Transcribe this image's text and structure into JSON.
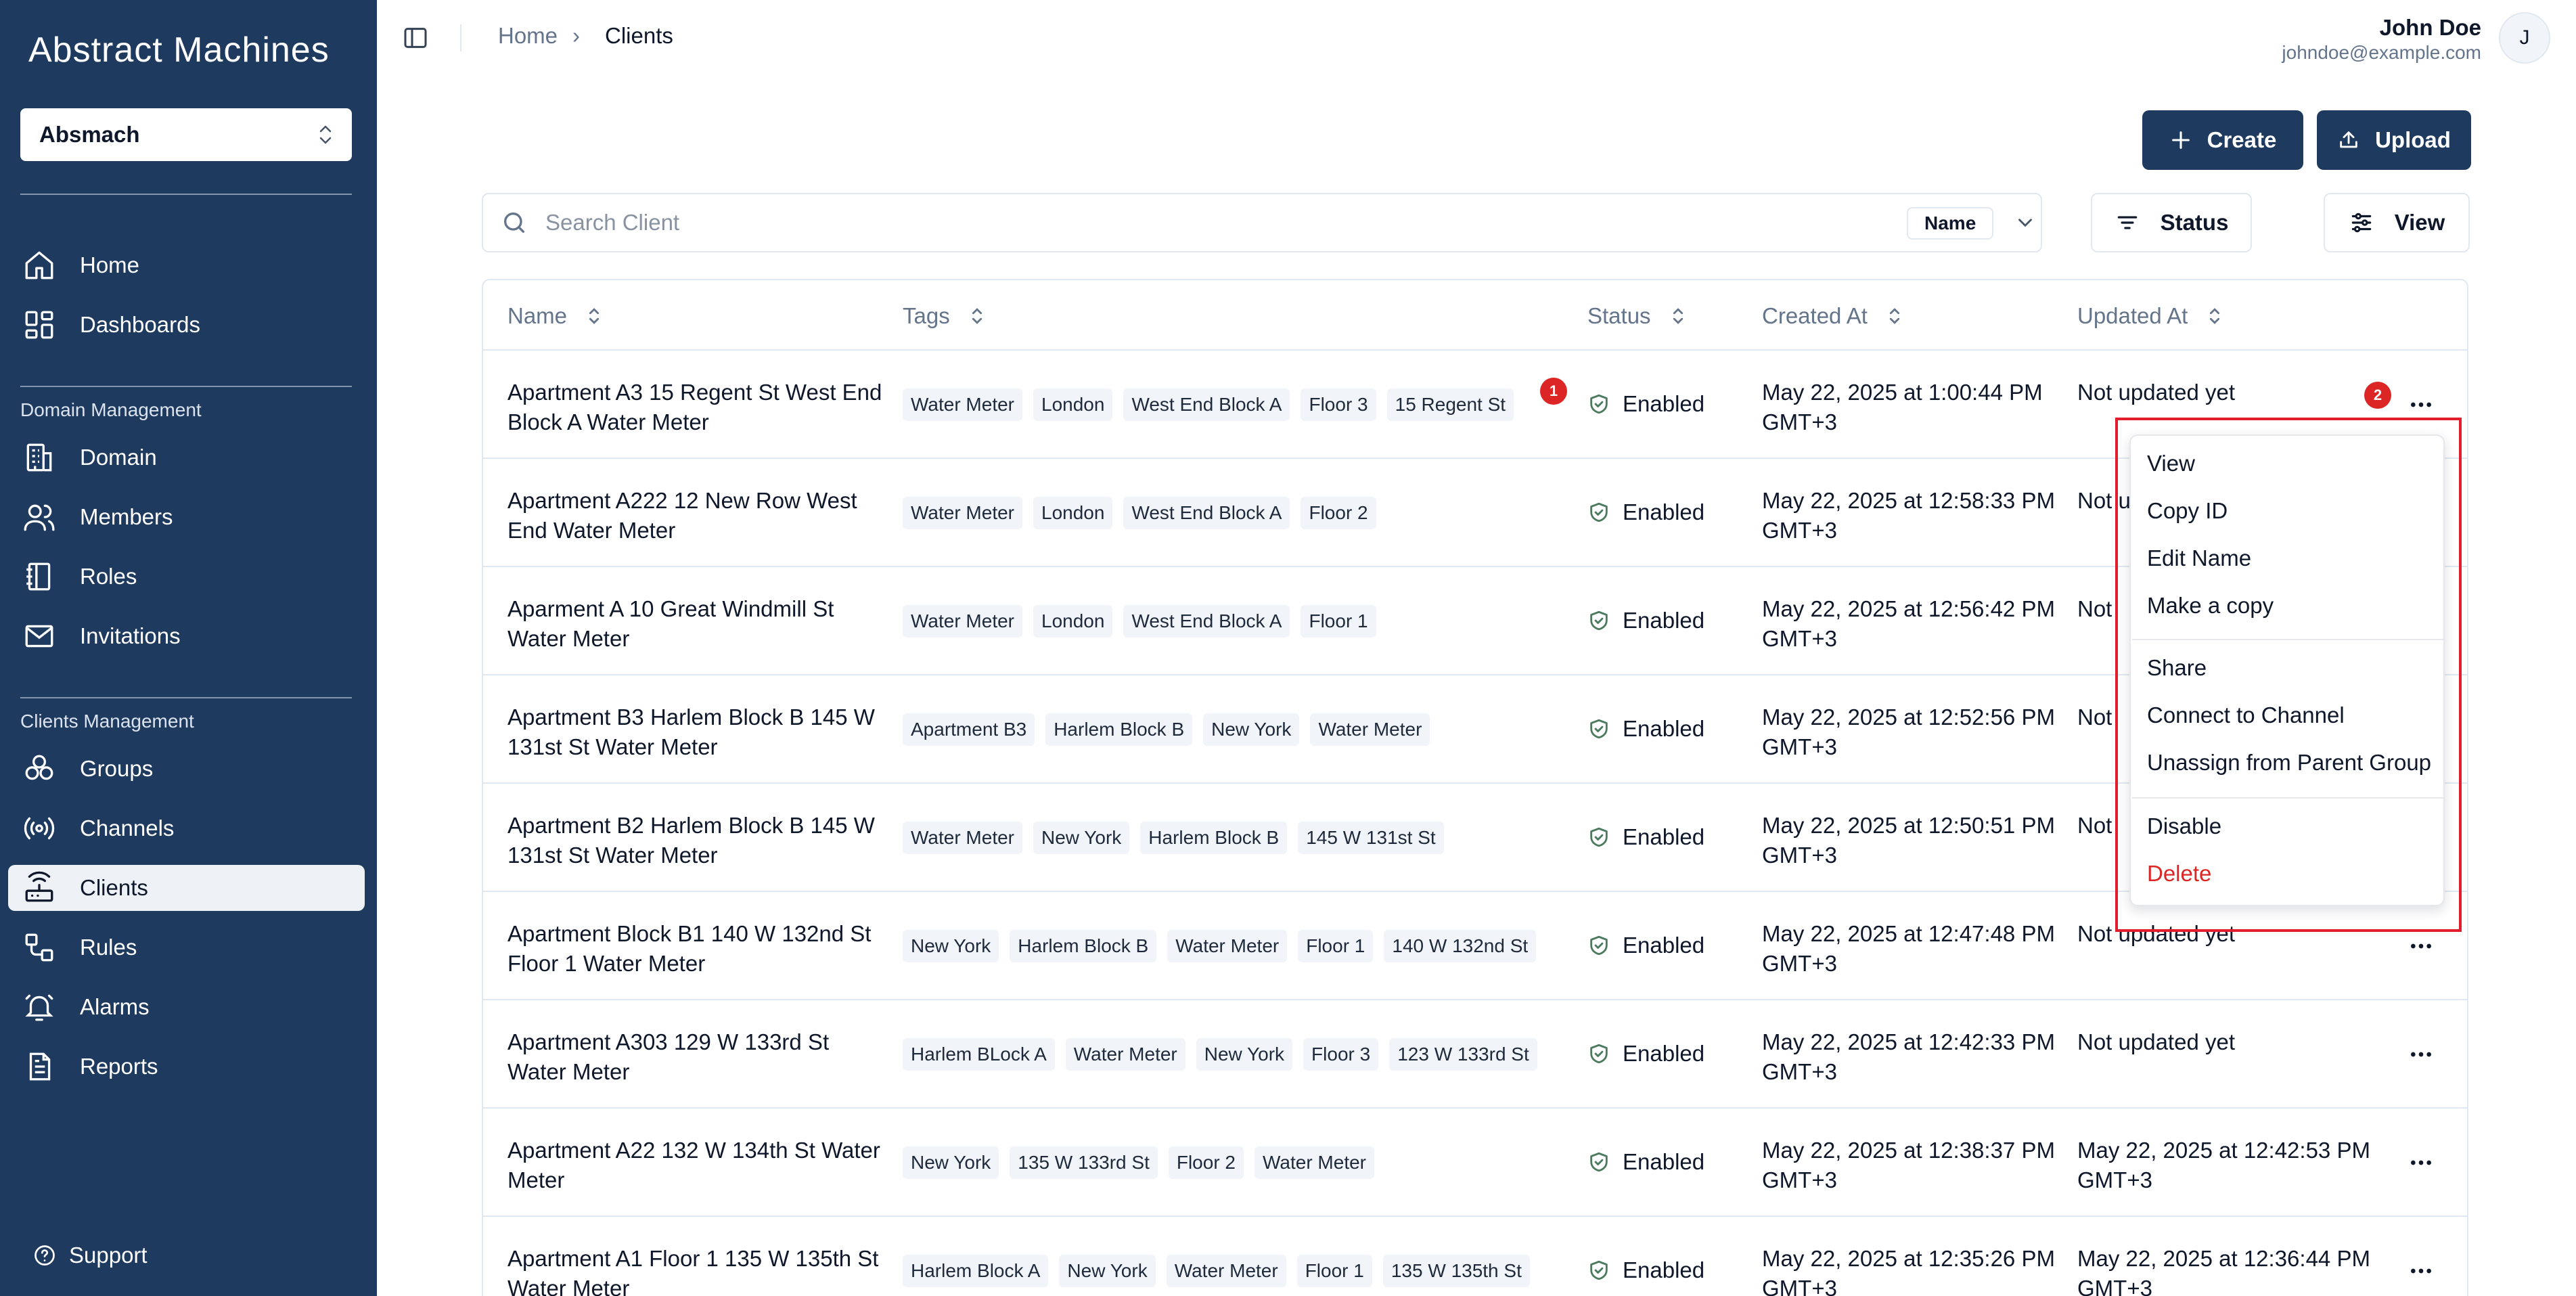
{
  "app": {
    "logo": "Abstract Machines",
    "workspace": "Absmach",
    "support_label": "Support"
  },
  "sidebar": {
    "top_items": [
      {
        "label": "Home",
        "icon": "home-icon"
      },
      {
        "label": "Dashboards",
        "icon": "dashboard-icon"
      }
    ],
    "domain_section": "Domain Management",
    "domain_items": [
      {
        "label": "Domain",
        "icon": "building-icon"
      },
      {
        "label": "Members",
        "icon": "users-icon"
      },
      {
        "label": "Roles",
        "icon": "notebook-icon"
      },
      {
        "label": "Invitations",
        "icon": "mail-icon"
      }
    ],
    "clients_section": "Clients Management",
    "clients_items": [
      {
        "label": "Groups",
        "icon": "groups-icon"
      },
      {
        "label": "Channels",
        "icon": "radio-icon"
      },
      {
        "label": "Clients",
        "icon": "router-icon",
        "active": true
      },
      {
        "label": "Rules",
        "icon": "workflow-icon"
      },
      {
        "label": "Alarms",
        "icon": "bell-icon"
      },
      {
        "label": "Reports",
        "icon": "report-icon"
      }
    ]
  },
  "header": {
    "breadcrumb_home": "Home",
    "breadcrumb_current": "Clients",
    "user_name": "John Doe",
    "user_email": "johndoe@example.com",
    "avatar_initial": "J"
  },
  "toolbar": {
    "create_label": "Create",
    "upload_label": "Upload",
    "search_placeholder": "Search Client",
    "search_field": "Name",
    "status_label": "Status",
    "view_label": "View"
  },
  "table": {
    "columns": [
      "Name",
      "Tags",
      "Status",
      "Created At",
      "Updated At"
    ],
    "rows": [
      {
        "name": "Apartment A3 15 Regent St West End Block A Water Meter",
        "tags": [
          "Water Meter",
          "London",
          "West End Block A",
          "Floor 3",
          "15 Regent St"
        ],
        "status": "Enabled",
        "created": "May 22, 2025 at 1:00:44 PM GMT+3",
        "updated": "Not updated yet"
      },
      {
        "name": "Apartment A222 12 New Row West End Water Meter",
        "tags": [
          "Water Meter",
          "London",
          "West End Block A",
          "Floor 2"
        ],
        "status": "Enabled",
        "created": "May 22, 2025 at 12:58:33 PM GMT+3",
        "updated": "Not u"
      },
      {
        "name": "Aparment A 10 Great Windmill St Water Meter",
        "tags": [
          "Water Meter",
          "London",
          "West End Block A",
          "Floor 1"
        ],
        "status": "Enabled",
        "created": "May 22, 2025 at 12:56:42 PM GMT+3",
        "updated": "Not"
      },
      {
        "name": "Apartment B3 Harlem Block B 145 W 131st St Water Meter",
        "tags": [
          "Apartment B3",
          "Harlem Block B",
          "New York",
          "Water Meter"
        ],
        "status": "Enabled",
        "created": "May 22, 2025 at 12:52:56 PM GMT+3",
        "updated": "Not"
      },
      {
        "name": "Apartment B2 Harlem Block B 145 W 131st St Water Meter",
        "tags": [
          "Water Meter",
          "New York",
          "Harlem Block B",
          "145 W 131st St"
        ],
        "status": "Enabled",
        "created": "May 22, 2025 at 12:50:51 PM GMT+3",
        "updated": "Not"
      },
      {
        "name": "Apartment Block B1 140 W 132nd St Floor 1 Water Meter",
        "tags": [
          "New York",
          "Harlem Block B",
          "Water Meter",
          "Floor 1",
          "140 W 132nd St"
        ],
        "status": "Enabled",
        "created": "May 22, 2025 at 12:47:48 PM GMT+3",
        "updated": "Not updated yet"
      },
      {
        "name": "Apartment A303 129 W 133rd St Water Meter",
        "tags": [
          "Harlem BLock A",
          "Water Meter",
          "New York",
          "Floor 3",
          "123 W 133rd St"
        ],
        "status": "Enabled",
        "created": "May 22, 2025 at 12:42:33 PM GMT+3",
        "updated": "Not updated yet"
      },
      {
        "name": "Apartment A22 132 W 134th St Water Meter",
        "tags": [
          "New York",
          "135 W 133rd St",
          "Floor 2",
          "Water Meter"
        ],
        "status": "Enabled",
        "created": "May 22, 2025 at 12:38:37 PM GMT+3",
        "updated": "May 22, 2025 at 12:42:53 PM GMT+3"
      },
      {
        "name": "Apartment A1 Floor 1 135 W 135th St Water Meter",
        "tags": [
          "Harlem Block A",
          "New York",
          "Water Meter",
          "Floor 1",
          "135 W 135th St"
        ],
        "status": "Enabled",
        "created": "May 22, 2025 at 12:35:26 PM GMT+3",
        "updated": "May 22, 2025 at 12:36:44 PM GMT+3"
      }
    ],
    "badge_1": "1",
    "badge_2": "2"
  },
  "context_menu": {
    "group1": [
      "View",
      "Copy ID",
      "Edit Name",
      "Make a copy"
    ],
    "group2": [
      "Share",
      "Connect to Channel",
      "Unassign from Parent Group"
    ],
    "group3": [
      "Disable",
      "Delete"
    ],
    "danger_color": "#dc2626"
  },
  "colors": {
    "sidebar_bg": "#1e3a5f",
    "accent": "#1e3a5f",
    "annotation_red": "#e11d2e",
    "badge_red": "#dc2626"
  }
}
